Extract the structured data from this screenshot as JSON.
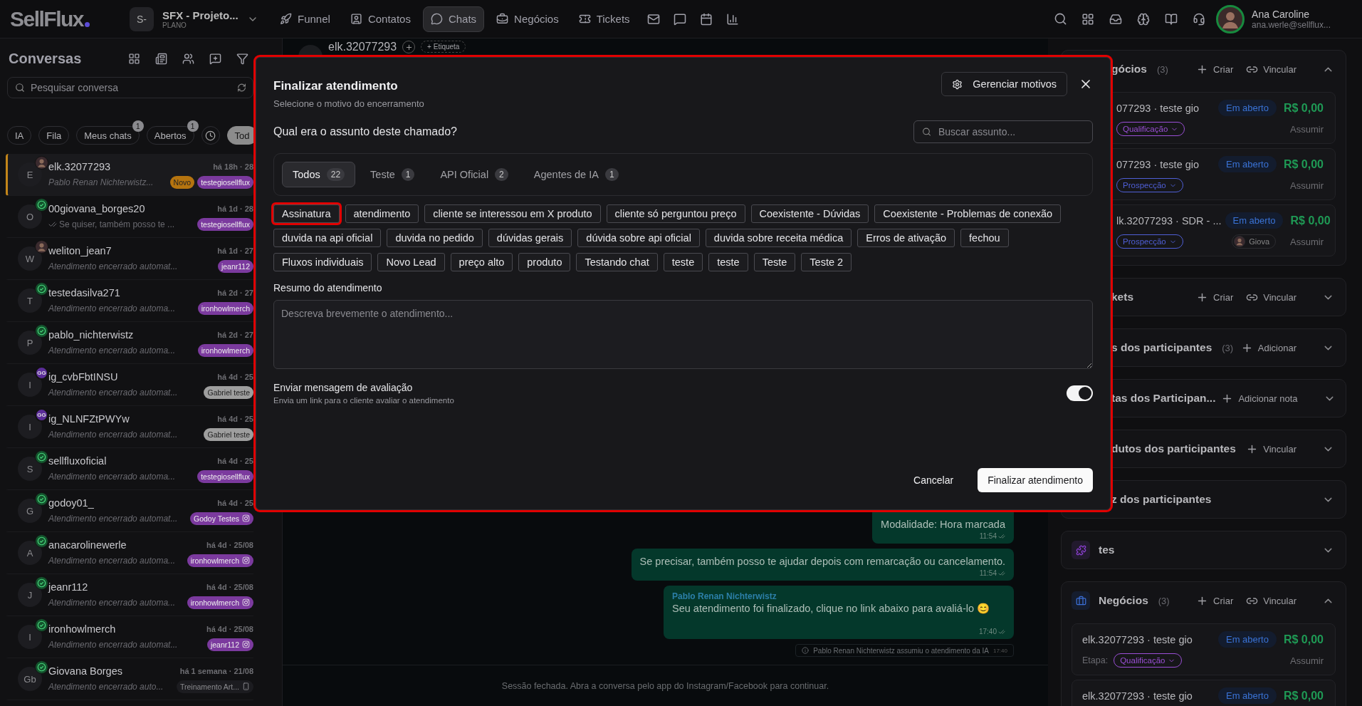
{
  "top_nav": {
    "logo": "SellFlux",
    "workspace": {
      "badge": "S-",
      "name": "SFX - Projeto...",
      "plan": "PLANO"
    },
    "items": [
      {
        "label": "Funnel",
        "selected": false
      },
      {
        "label": "Contatos",
        "selected": false
      },
      {
        "label": "Chats",
        "selected": true
      },
      {
        "label": "Negócios",
        "selected": false
      },
      {
        "label": "Tickets",
        "selected": false
      }
    ],
    "user": {
      "name": "Ana Caroline",
      "email": "ana.werle@sellflux..."
    }
  },
  "sidebar": {
    "title": "Conversas",
    "search": {
      "placeholder": "Pesquisar conversa"
    },
    "filters": [
      {
        "kind": "chip",
        "label": "IA",
        "selected": false
      },
      {
        "kind": "chip",
        "label": "Fila",
        "selected": false
      },
      {
        "kind": "chip",
        "label": "Meus chats",
        "badge": "1",
        "selected": false
      },
      {
        "kind": "chip",
        "label": "Abertos",
        "badge": "1",
        "selected": false
      },
      {
        "kind": "icon",
        "selected": false
      },
      {
        "kind": "chip",
        "label": "Tod",
        "selected": true
      }
    ],
    "conversations": [
      {
        "initial": "E",
        "badge": {
          "kind": "photo"
        },
        "name": "elk.32077293",
        "time": "há 18h · 28",
        "preview": "Pablo Renan Nichterwistz...",
        "read_ticks": false,
        "selected": true,
        "tags": [
          {
            "kind": "plain",
            "label": "Novo",
            "color": "#b5740f"
          },
          {
            "kind": "plain",
            "label": "testegiosellflux",
            "color": "#7b3a9e"
          }
        ]
      },
      {
        "initial": "O",
        "badge": {
          "kind": "whatsapp"
        },
        "name": "00giovana_borges20",
        "time": "há 1d · 28",
        "preview": "Se quiser, também posso te ...",
        "read_ticks": true,
        "selected": false,
        "tags": [
          {
            "kind": "plain",
            "label": "testegiosellflux",
            "color": "#7b3a9e"
          }
        ]
      },
      {
        "initial": "W",
        "badge": {
          "kind": "photo"
        },
        "name": "weliton_jean7",
        "time": "há 1d · 27",
        "preview": "Atendimento encerrado automat...",
        "read_ticks": false,
        "selected": false,
        "tags": [
          {
            "kind": "plain",
            "label": "jeanr112",
            "color": "#7b3a9e"
          }
        ]
      },
      {
        "initial": "T",
        "badge": {
          "kind": "whatsapp"
        },
        "name": "testedasilva271",
        "time": "há 2d · 27",
        "preview": "Atendimento encerrado automa...",
        "read_ticks": false,
        "selected": false,
        "tags": [
          {
            "kind": "plain",
            "label": "ironhowlmerch",
            "color": "#7b3a9e"
          }
        ]
      },
      {
        "initial": "P",
        "badge": {
          "kind": "whatsapp"
        },
        "name": "pablo_nichterwistz",
        "time": "há 2d · 27",
        "preview": "Atendimento encerrado automa...",
        "read_ticks": false,
        "selected": false,
        "tags": [
          {
            "kind": "plain",
            "label": "ironhowlmerch",
            "color": "#7b3a9e"
          }
        ]
      },
      {
        "initial": "I",
        "badge": {
          "kind": "text",
          "label": "GG"
        },
        "name": "ig_cvbFbtINSU",
        "time": "há 4d · 25",
        "preview": "Atendimento encerrado automat...",
        "read_ticks": false,
        "selected": false,
        "tags": [
          {
            "kind": "plain",
            "label": "Gabriel teste",
            "color": "#9e9e9e"
          }
        ]
      },
      {
        "initial": "I",
        "badge": {
          "kind": "text",
          "label": "GG"
        },
        "name": "ig_NLNFZtPWYw",
        "time": "há 4d · 25",
        "preview": "Atendimento encerrado automat...",
        "read_ticks": false,
        "selected": false,
        "tags": [
          {
            "kind": "plain",
            "label": "Gabriel teste",
            "color": "#9e9e9e"
          }
        ]
      },
      {
        "initial": "S",
        "badge": {
          "kind": "whatsapp"
        },
        "name": "sellfluxoficial",
        "time": "há 4d · 25",
        "preview": "Atendimento encerrado automa...",
        "read_ticks": false,
        "selected": false,
        "tags": [
          {
            "kind": "plain",
            "label": "testegiosellflux",
            "color": "#7b3a9e"
          }
        ]
      },
      {
        "initial": "G",
        "badge": {
          "kind": "whatsapp"
        },
        "name": "godoy01_",
        "time": "há 4d · 25",
        "preview": "Atendimento encerrado automat...",
        "read_ticks": false,
        "selected": false,
        "tags": [
          {
            "kind": "instagram",
            "label": "Godoy Testes",
            "color": "#7b3a9e"
          }
        ]
      },
      {
        "initial": "A",
        "badge": {
          "kind": "whatsapp"
        },
        "name": "anacarolinewerle",
        "time": "há 4d · 25/08",
        "preview": "Atendimento encerrado automa...",
        "read_ticks": false,
        "selected": false,
        "tags": [
          {
            "kind": "instagram",
            "label": "ironhowlmerch",
            "color": "#7b3a9e"
          }
        ]
      },
      {
        "initial": "J",
        "badge": {
          "kind": "whatsapp"
        },
        "name": "jeanr112",
        "time": "há 4d · 25/08",
        "preview": "Atendimento encerrado automa...",
        "read_ticks": false,
        "selected": false,
        "tags": [
          {
            "kind": "instagram",
            "label": "ironhowlmerch",
            "color": "#7b3a9e"
          }
        ]
      },
      {
        "initial": "I",
        "badge": {
          "kind": "whatsapp"
        },
        "name": "ironhowlmerch",
        "time": "há 4d · 25/08",
        "preview": "Atendimento encerrado automat...",
        "read_ticks": false,
        "selected": false,
        "tags": [
          {
            "kind": "instagram",
            "label": "jeanr112",
            "color": "#7b3a9e"
          }
        ]
      },
      {
        "initial": "Gb",
        "badge": {
          "kind": "whatsapp"
        },
        "name": "Giovana Borges",
        "time": "há 1 semana · 21/08",
        "preview": "Atendimento encerrado auto...",
        "read_ticks": false,
        "selected": false,
        "tags": [
          {
            "kind": "phone",
            "label": "Treinamento Art...",
            "color": "#1c1c20"
          }
        ]
      }
    ]
  },
  "chat": {
    "contact": "elk.32077293",
    "label_button": "+ Etiqueta",
    "messages": [
      {
        "kind": "outgoing",
        "text": "Modalidade: Hora marcada",
        "time": "11:54"
      },
      {
        "kind": "outgoing",
        "text": "Se precisar, também posso te ajudar depois com remarcação ou cancelamento.",
        "time": "11:54"
      },
      {
        "kind": "outgoing",
        "sender": "Pablo Renan Nichterwistz",
        "text": "Seu atendimento foi finalizado, clique no link abaixo para avaliá-lo 😊",
        "time": "17:40"
      },
      {
        "kind": "system",
        "text": "Pablo Renan Nichterwistz assumiu o atendimento da IA",
        "time": "17:40"
      }
    ],
    "footer": "Sessão fechada. Abra a conversa pelo app do Instagram/Facebook para continuar."
  },
  "right_panel": {
    "sections_behind_dialog": [
      {
        "title": "gócios",
        "count": "(3)",
        "expanded": true,
        "actions": [
          {
            "kind": "create",
            "label": "Criar"
          },
          {
            "kind": "link",
            "label": "Vincular"
          }
        ],
        "deals": [
          {
            "title": "077293 · teste gio",
            "status": "Em aberto",
            "value": "R$ 0,00",
            "stage": "Qualificação",
            "color": "#9b4fd6",
            "action": "Assumir"
          },
          {
            "title": "077293 · teste gio",
            "status": "Em aberto",
            "value": "R$ 0,00",
            "stage": "Prospecção",
            "color": "#4f5fd6",
            "action": "Assumir"
          },
          {
            "title": "lk.32077293 · SDR - ...",
            "status": "Em aberto",
            "value": "R$ 0,00",
            "stage": "Prospecção",
            "color": "#4f5fd6",
            "assignee": "Giova",
            "action": "Assumir"
          }
        ]
      },
      {
        "title": "kets",
        "expanded": false,
        "actions": [
          {
            "kind": "create",
            "label": "Criar"
          },
          {
            "kind": "link",
            "label": "Vincular"
          }
        ]
      },
      {
        "title": "s dos participantes",
        "count": "(3)",
        "expanded": false,
        "actions": [
          {
            "kind": "create",
            "label": "Adicionar"
          }
        ]
      },
      {
        "title": "tas dos Participan...",
        "expanded": false,
        "actions": [
          {
            "kind": "create",
            "label": "Adicionar nota"
          }
        ]
      },
      {
        "title": "dutos dos participantes",
        "expanded": false,
        "actions": [
          {
            "kind": "create",
            "label": "Vincular"
          }
        ]
      },
      {
        "title": "z dos participantes",
        "expanded": false
      }
    ],
    "sections": [
      {
        "title": "tes",
        "expanded": false
      },
      {
        "title": "Negócios",
        "count": "(3)",
        "expanded": true,
        "actions": [
          {
            "kind": "create",
            "label": "Criar"
          },
          {
            "kind": "link",
            "label": "Vincular"
          }
        ],
        "deals": [
          {
            "title": "elk.32077293 · teste gio",
            "status": "Em aberto",
            "value": "R$ 0,00",
            "stage_label": "Etapa:",
            "stage": "Qualificação",
            "color": "#9b4fd6",
            "action": "Assumir"
          },
          {
            "title": "elk.32077293 · teste gio",
            "status": "Em aberto",
            "value": "R$ 0,00"
          }
        ]
      }
    ]
  },
  "dialog": {
    "highlighted": true,
    "title": "Finalizar atendimento",
    "subtitle": "Selecione o motivo do encerramento",
    "manage_button": "Gerenciar motivos",
    "question": "Qual era o assunto deste chamado?",
    "search": {
      "placeholder": "Buscar assunto..."
    },
    "tabs": [
      {
        "label": "Todos",
        "count": "22",
        "selected": true
      },
      {
        "label": "Teste",
        "count": "1",
        "selected": false
      },
      {
        "label": "API Oficial",
        "count": "2",
        "selected": false
      },
      {
        "label": "Agentes de IA",
        "count": "1",
        "selected": false
      }
    ],
    "subjects": [
      {
        "label": "Assinatura",
        "highlighted": true
      },
      {
        "label": "atendimento",
        "highlighted": false
      },
      {
        "label": "cliente se interessou em X produto",
        "highlighted": false
      },
      {
        "label": "cliente só perguntou preço",
        "highlighted": false
      },
      {
        "label": "Coexistente - Dúvidas",
        "highlighted": false
      },
      {
        "label": "Coexistente - Problemas de conexão",
        "highlighted": false
      },
      {
        "label": "duvida na api oficial",
        "highlighted": false
      },
      {
        "label": "duvida no pedido",
        "highlighted": false
      },
      {
        "label": "dúvidas gerais",
        "highlighted": false
      },
      {
        "label": "dúvida sobre api oficial",
        "highlighted": false
      },
      {
        "label": "duvida sobre receita médica",
        "highlighted": false
      },
      {
        "label": "Erros de ativação",
        "highlighted": false
      },
      {
        "label": "fechou",
        "highlighted": false
      },
      {
        "label": "Fluxos individuais",
        "highlighted": false
      },
      {
        "label": "Novo Lead",
        "highlighted": false
      },
      {
        "label": "preço alto",
        "highlighted": false
      },
      {
        "label": "produto",
        "highlighted": false
      },
      {
        "label": "Testando chat",
        "highlighted": false
      },
      {
        "label": "teste",
        "highlighted": false
      },
      {
        "label": "teste",
        "highlighted": false
      },
      {
        "label": "Teste",
        "highlighted": false
      },
      {
        "label": "Teste 2",
        "highlighted": false
      }
    ],
    "summary": {
      "label": "Resumo do atendimento",
      "placeholder": "Descreva brevemente o atendimento..."
    },
    "rating_toggle": {
      "label": "Enviar mensagem de avaliação",
      "description": "Envia um link para o cliente avaliar o atendimento",
      "on": true
    },
    "buttons": [
      {
        "kind": "secondary",
        "label": "Cancelar"
      },
      {
        "kind": "primary",
        "label": "Finalizar atendimento"
      }
    ]
  }
}
